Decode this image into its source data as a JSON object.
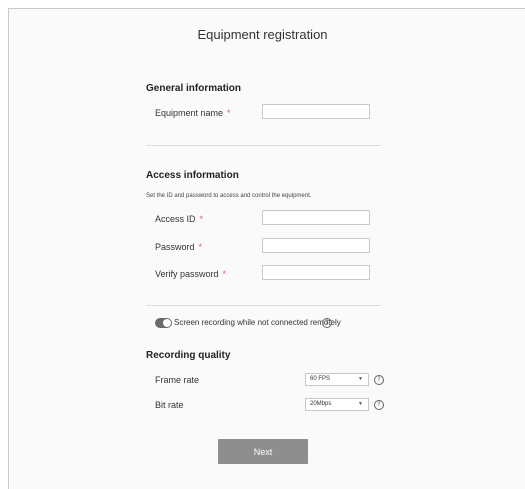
{
  "page": {
    "title": "Equipment registration"
  },
  "general": {
    "heading": "General information",
    "equipment_name_label": "Equipment name",
    "required_mark": "*"
  },
  "access": {
    "heading": "Access information",
    "description": "Set the ID and password to access and control the equipment.",
    "access_id_label": "Access ID",
    "password_label": "Password",
    "verify_password_label": "Verify password",
    "required_mark": "*"
  },
  "recording_toggle": {
    "label": "Screen recording while not connected remotely",
    "state": "on",
    "help_icon": "?"
  },
  "recording_quality": {
    "heading": "Recording quality",
    "frame_rate_label": "Frame rate",
    "frame_rate_value": "60 FPS",
    "bit_rate_label": "Bit rate",
    "bit_rate_value": "20Mbps",
    "help_icon": "?"
  },
  "actions": {
    "next_label": "Next"
  },
  "colors": {
    "button": "#8e8e8e",
    "toggle": "#6a6a6a",
    "required": "#e05a5a"
  }
}
